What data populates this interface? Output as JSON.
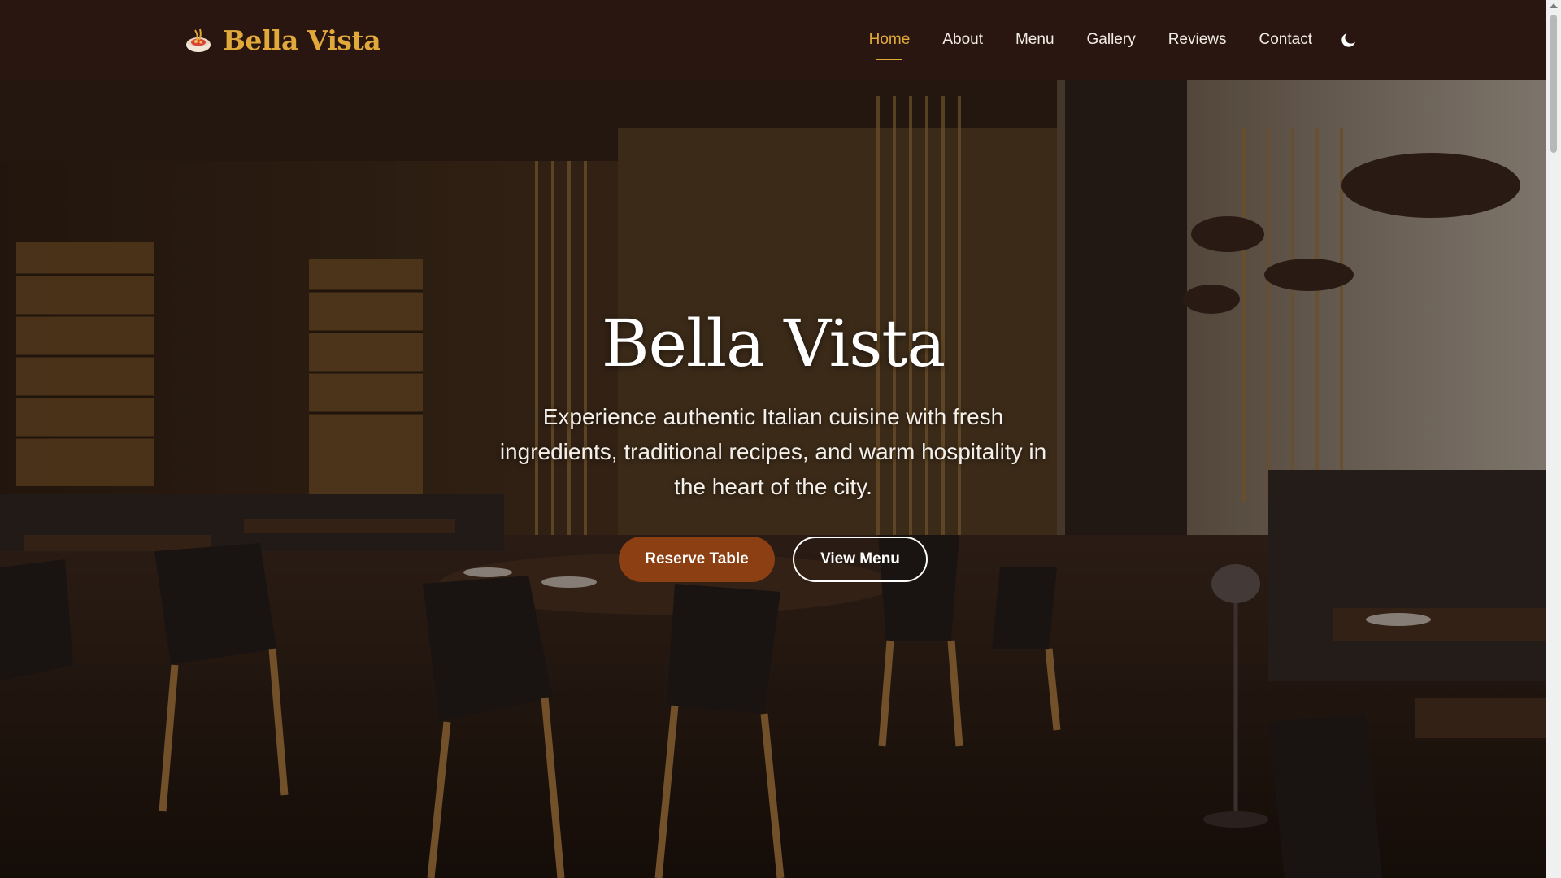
{
  "brand": {
    "name": "Bella Vista",
    "icon": "pasta-bowl-icon",
    "accent_color": "#e0a93a"
  },
  "nav": {
    "items": [
      {
        "label": "Home",
        "active": true
      },
      {
        "label": "About",
        "active": false
      },
      {
        "label": "Menu",
        "active": false
      },
      {
        "label": "Gallery",
        "active": false
      },
      {
        "label": "Reviews",
        "active": false
      },
      {
        "label": "Contact",
        "active": false
      }
    ],
    "theme_toggle_icon": "moon-icon"
  },
  "hero": {
    "title": "Bella Vista",
    "subtitle": "Experience authentic Italian cuisine with fresh ingredients, traditional recipes, and warm hospitality in the heart of the city.",
    "primary_button": "Reserve Table",
    "secondary_button": "View Menu",
    "primary_color": "#8b3f12"
  }
}
